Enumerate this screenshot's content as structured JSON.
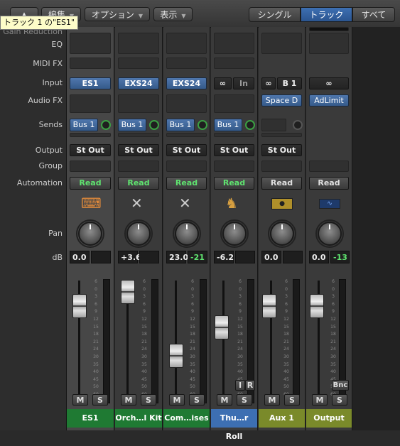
{
  "toolbar": {
    "edit_label": "編集",
    "options_label": "オプション",
    "view_label": "表示",
    "single_label": "シングル",
    "track_label": "トラック",
    "all_label": "すべて"
  },
  "tooltip": "トラック 1 の\"ES1\"",
  "row_labels": {
    "gain_reduction": "Gain Reduction",
    "eq": "EQ",
    "midi_fx": "MIDI FX",
    "input": "Input",
    "audio_fx": "Audio FX",
    "sends": "Sends",
    "output": "Output",
    "group": "Group",
    "automation": "Automation",
    "pan": "Pan",
    "db": "dB"
  },
  "colors": {
    "midi_strip": "#1f7a33",
    "aux_strip": "#7a8a2a",
    "read_green": "#5fe36f",
    "selected_blue": "#3d6fb2",
    "bus_blue": "#4f77ad"
  },
  "scale_ticks": [
    "6",
    "0",
    "3",
    "6",
    "9",
    "12",
    "15",
    "18",
    "21",
    "24",
    "30",
    "35",
    "40",
    "45",
    "50",
    "60"
  ],
  "strips": [
    {
      "name": "ES1",
      "input": "ES1",
      "send": "Bus 1",
      "output": "St Out",
      "automation": "Read",
      "db": "0.0",
      "peak": "",
      "icon": "keyboard-icon",
      "solo_label": "S",
      "mute_label": "M",
      "fader": 0.78,
      "name_color": "#1f7a33",
      "selected": true
    },
    {
      "name": "Orch…l Kit",
      "input": "EXS24",
      "send": "Bus 1",
      "output": "St Out",
      "automation": "Read",
      "db": "+3.6",
      "peak": "",
      "icon": "keyboard-stand-icon",
      "solo_label": "S",
      "mute_label": "M",
      "fader": 0.9,
      "name_color": "#1f7a33",
      "selected": false
    },
    {
      "name": "Com…ises",
      "input": "EXS24",
      "send": "Bus 1",
      "output": "St Out",
      "automation": "Read",
      "db": "23.0",
      "peak": "-21",
      "icon": "keyboard-stand-icon",
      "solo_label": "S",
      "mute_label": "M",
      "fader": 0.15,
      "name_color": "#1f7a33",
      "selected": false
    },
    {
      "name": "Thu…r Roll",
      "input": "In",
      "send": "Bus 1",
      "output": "St Out",
      "automation": "Read",
      "db": "-6.2",
      "peak": "",
      "icon": "drum-kit-icon",
      "solo_label": "S",
      "mute_label": "M",
      "input_label": "I",
      "record_label": "R",
      "fader": 0.48,
      "name_color": "#3d6fb2",
      "selected": false
    },
    {
      "name": "Aux 1",
      "input": "B 1",
      "audio_fx": "Space D",
      "output": "St Out",
      "automation": "Read",
      "db": "0.0",
      "peak": "",
      "icon": "aux-icon",
      "solo_label": "S",
      "mute_label": "M",
      "fader": 0.78,
      "name_color": "#7a8a2a",
      "selected": false
    },
    {
      "name": "Output",
      "audio_fx": "AdLimit",
      "automation": "Read",
      "db": "0.0",
      "peak": "-13",
      "icon": "waveform-icon",
      "solo_label": "S",
      "mute_label": "M",
      "bounce_label": "Bnc",
      "fader": 0.78,
      "name_color": "#7a8a2a",
      "selected": false
    }
  ]
}
